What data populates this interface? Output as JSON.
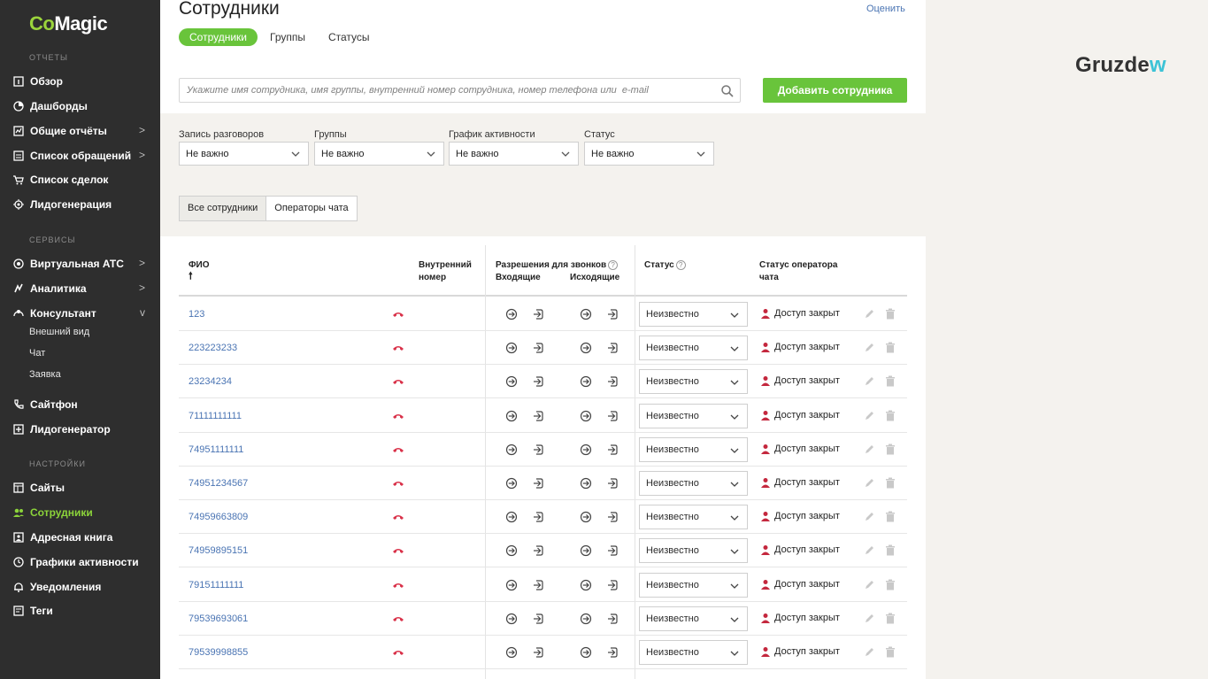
{
  "sidebar": {
    "logo": {
      "co": "Co",
      "magic": "Magic"
    },
    "sections": {
      "reports": "ОТЧЕТЫ",
      "services": "СЕРВИСЫ",
      "settings": "НАСТРОЙКИ"
    },
    "items": [
      {
        "label": "Обзор",
        "icon": "overview-icon"
      },
      {
        "label": "Дашборды",
        "icon": "dashboards-icon"
      },
      {
        "label": "Общие отчёты",
        "icon": "reports-icon",
        "chevron": ">"
      },
      {
        "label": "Список обращений",
        "icon": "requests-icon",
        "chevron": ">"
      },
      {
        "label": "Список сделок",
        "icon": "cart-icon"
      },
      {
        "label": "Лидогенерация",
        "icon": "leadgen-icon"
      },
      {
        "label": "Виртуальная АТС",
        "icon": "pbx-icon",
        "chevron": ">"
      },
      {
        "label": "Аналитика",
        "icon": "analytics-icon",
        "chevron": ">"
      },
      {
        "label": "Консультант",
        "icon": "consultant-icon",
        "chevron": "v"
      },
      {
        "label": "Сайтфон",
        "icon": "sitephone-icon"
      },
      {
        "label": "Лидогенератор",
        "icon": "leadgenerator-icon"
      },
      {
        "label": "Сайты",
        "icon": "sites-icon"
      },
      {
        "label": "Сотрудники",
        "icon": "employees-icon",
        "active": true
      },
      {
        "label": "Адресная книга",
        "icon": "addressbook-icon"
      },
      {
        "label": "Графики активности",
        "icon": "schedule-icon"
      },
      {
        "label": "Уведомления",
        "icon": "bell-icon"
      },
      {
        "label": "Теги",
        "icon": "tags-icon"
      }
    ],
    "consultant_sub": [
      "Внешний вид",
      "Чат",
      "Заявка"
    ]
  },
  "header": {
    "title": "Сотрудники",
    "rate_link": "Оценить",
    "tabs": [
      "Сотрудники",
      "Группы",
      "Статусы"
    ]
  },
  "search": {
    "placeholder": "Укажите имя сотрудника, имя группы, внутренний номер сотрудника, номер телефона или  e-mail",
    "add_button": "Добавить сотрудника"
  },
  "filters": [
    {
      "label": "Запись разговоров",
      "value": "Не важно"
    },
    {
      "label": "Группы",
      "value": "Не важно"
    },
    {
      "label": "График активности",
      "value": "Не важно"
    },
    {
      "label": "Статус",
      "value": "Не важно"
    }
  ],
  "segment": {
    "all": "Все сотрудники",
    "chat": "Операторы чата"
  },
  "table": {
    "headers": {
      "fio": "ФИО",
      "sort_arrow": "🠕",
      "internal_1": "Внутренний",
      "internal_2": "номер",
      "permissions": "Разрешения для звонков",
      "incoming": "Входящие",
      "outgoing": "Исходящие",
      "status": "Статус",
      "chat_status_1": "Статус оператора",
      "chat_status_2": "чата"
    },
    "rows": [
      {
        "name": "123",
        "status": "Неизвестно",
        "access": "Доступ закрыт"
      },
      {
        "name": "223223233",
        "status": "Неизвестно",
        "access": "Доступ закрыт"
      },
      {
        "name": "23234234",
        "status": "Неизвестно",
        "access": "Доступ закрыт"
      },
      {
        "name": "71111111111",
        "status": "Неизвестно",
        "access": "Доступ закрыт"
      },
      {
        "name": "74951111111",
        "status": "Неизвестно",
        "access": "Доступ закрыт"
      },
      {
        "name": "74951234567",
        "status": "Неизвестно",
        "access": "Доступ закрыт"
      },
      {
        "name": "74959663809",
        "status": "Неизвестно",
        "access": "Доступ закрыт"
      },
      {
        "name": "74959895151",
        "status": "Неизвестно",
        "access": "Доступ закрыт"
      },
      {
        "name": "79151111111",
        "status": "Неизвестно",
        "access": "Доступ закрыт"
      },
      {
        "name": "79539693061",
        "status": "Неизвестно",
        "access": "Доступ закрыт"
      },
      {
        "name": "79539998855",
        "status": "Неизвестно",
        "access": "Доступ закрыт"
      }
    ]
  },
  "brand": {
    "main": "Gruzde",
    "accent": "w"
  },
  "colors": {
    "accent_green": "#69c43b",
    "link_blue": "#4a74b3",
    "hangup_red": "#d9324a",
    "sidebar_bg": "#2e2e2e"
  }
}
